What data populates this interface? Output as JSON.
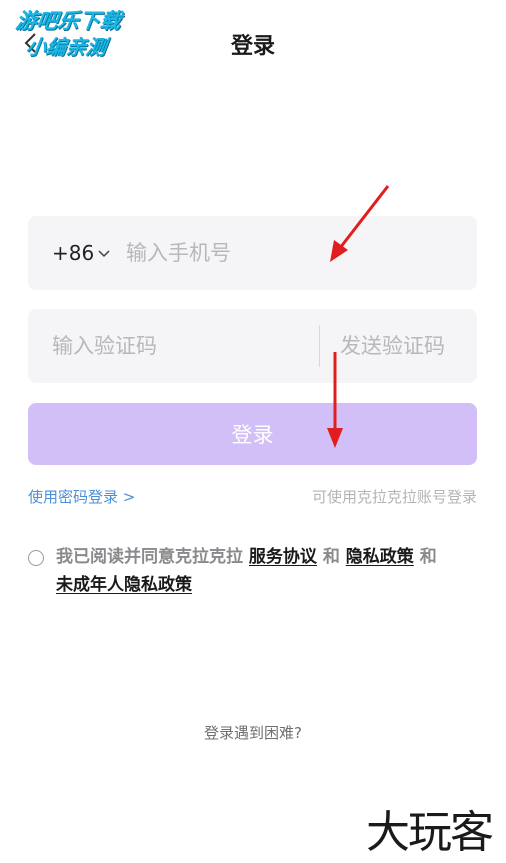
{
  "header": {
    "title": "登录",
    "back_icon": "chevron-left-icon",
    "watermark_line1": "游吧乐下载",
    "watermark_line2": "小编亲测"
  },
  "phone_field": {
    "country_code": "+86",
    "country_dropdown_icon": "chevron-down-icon",
    "placeholder": "输入手机号",
    "value": ""
  },
  "code_field": {
    "placeholder": "输入验证码",
    "value": "",
    "send_code_label": "发送验证码"
  },
  "login_button": {
    "label": "登录",
    "color": "#d2bff7"
  },
  "links": {
    "password_login": "使用密码登录 >",
    "account_login": "可使用克拉克拉账号登录"
  },
  "agreement": {
    "prefix": "我已阅读并同意克拉克拉",
    "service": "服务协议",
    "and1": "和",
    "privacy": "隐私政策",
    "and2": "和",
    "minor_privacy": "未成年人隐私政策"
  },
  "trouble_label": "登录遇到困难?",
  "brand_watermark": "大玩客",
  "colors": {
    "accent_link": "#4a90d9",
    "field_bg": "#f5f5f7",
    "arrow": "#e01e1e"
  }
}
